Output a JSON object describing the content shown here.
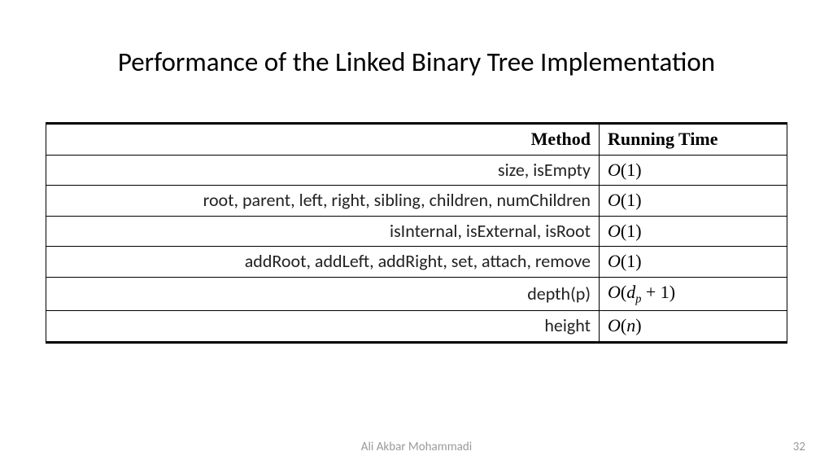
{
  "title": "Performance of the Linked Binary Tree Implementation",
  "table": {
    "headers": {
      "method": "Method",
      "runtime": "Running Time"
    },
    "rows": [
      {
        "method": "size, isEmpty",
        "runtime_html": "<span class='upright'></span>O<span class='upright'>(1)</span>"
      },
      {
        "method": "root, parent, left, right, sibling, children, numChildren",
        "runtime_html": "O<span class='upright'>(1)</span>"
      },
      {
        "method": "isInternal, isExternal, isRoot",
        "runtime_html": "O<span class='upright'>(1)</span>"
      },
      {
        "method": "addRoot, addLeft, addRight, set, attach, remove",
        "runtime_html": "O<span class='upright'>(1)</span>"
      },
      {
        "method": "depth(p)",
        "runtime_html": "O<span class='upright'>(</span>d<span class='sub'>p</span><span class='upright'> + 1)</span>"
      },
      {
        "method": "height",
        "runtime_html": "O<span class='upright'>(</span>n<span class='upright'>)</span>"
      }
    ]
  },
  "footer": {
    "author": "Ali Akbar Mohammadi",
    "page": "32"
  },
  "chart_data": {
    "type": "table",
    "title": "Performance of the Linked Binary Tree Implementation",
    "columns": [
      "Method",
      "Running Time"
    ],
    "rows": [
      [
        "size, isEmpty",
        "O(1)"
      ],
      [
        "root, parent, left, right, sibling, children, numChildren",
        "O(1)"
      ],
      [
        "isInternal, isExternal, isRoot",
        "O(1)"
      ],
      [
        "addRoot, addLeft, addRight, set, attach, remove",
        "O(1)"
      ],
      [
        "depth(p)",
        "O(d_p + 1)"
      ],
      [
        "height",
        "O(n)"
      ]
    ]
  }
}
